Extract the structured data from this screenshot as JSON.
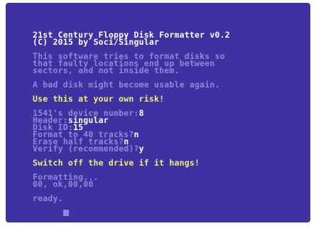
{
  "title": "21st Century Floppy Disk Formatter v0.2",
  "copyright": "(C) 2015 by Soci/Singular",
  "description": [
    "This software tries to format disks so",
    "that faulty locations end up between",
    "sectors, and not inside them."
  ],
  "bad_disk_note": "A bad disk might become usable again.",
  "risk_warning": "Use this at your own risk!",
  "prompts": {
    "device_label": "1541's device number:",
    "device_value": "8",
    "header_label": "Header:",
    "header_value": "singular",
    "disk_id_label": "Disk ID:",
    "disk_id_value": "15",
    "format40_label": "Format to 40 tracks?",
    "format40_value": "n",
    "erase_half_label": "Erase half tracks?",
    "erase_half_value": "n",
    "verify_label": "Verify (recommended)?",
    "verify_value": "y"
  },
  "hang_warning": "Switch off the drive if it hangs!",
  "status": {
    "formatting": "Formatting...",
    "result": "00, ok,00,00"
  },
  "ready": "ready.",
  "colors": {
    "background": "#3e31a2",
    "text_light": "#8e87d9",
    "text_white": "#ffffff",
    "text_yellow": "#eef070"
  }
}
